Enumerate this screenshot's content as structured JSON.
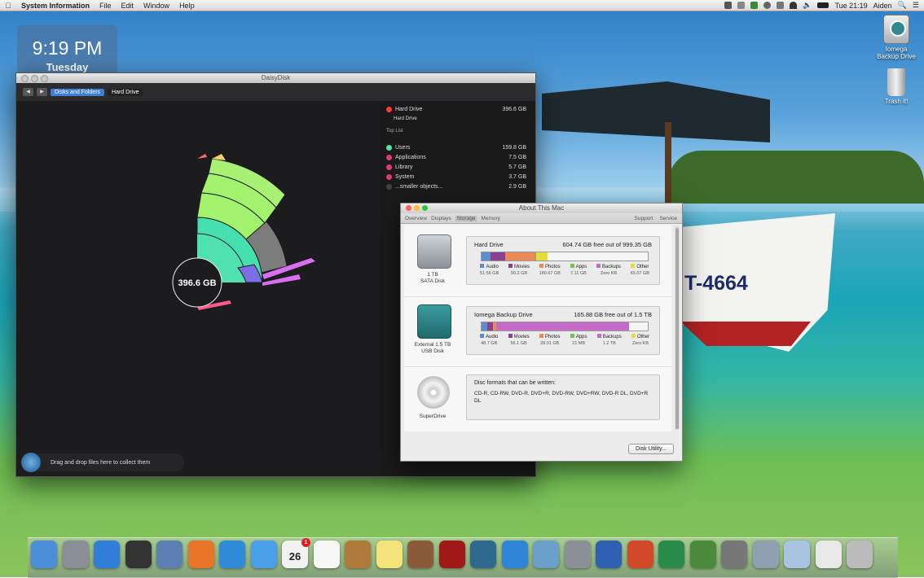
{
  "menubar": {
    "app_name": "System Information",
    "menus": [
      "File",
      "Edit",
      "Window",
      "Help"
    ],
    "clock": "Tue 21:19",
    "user": "Aiden"
  },
  "clock_widget": {
    "time": "9:19 PM",
    "day": "Tuesday"
  },
  "desktop_icons": [
    {
      "label": "Iomega\nBackup Drive",
      "icon": "backup-drive-icon"
    },
    {
      "label": "Trash it!",
      "icon": "trash-icon"
    }
  ],
  "boat_registration": "T-4664",
  "daisydisk": {
    "title": "DaisyDisk",
    "breadcrumbs": [
      "Disks and Folders",
      "Hard Drive"
    ],
    "center_label": "396.6 GB",
    "drive": {
      "name": "Hard Drive",
      "size": "396.6 GB",
      "sub": "Hard Drive"
    },
    "top_list_label": "Top List",
    "items": [
      {
        "name": "Users",
        "size": "159.8 GB",
        "color": "#55e3a4"
      },
      {
        "name": "Applications",
        "size": "7.5 GB",
        "color": "#e5397a"
      },
      {
        "name": "Library",
        "size": "5.7 GB",
        "color": "#e5397a"
      },
      {
        "name": "System",
        "size": "3.7 GB",
        "color": "#e5397a"
      },
      {
        "name": "...smaller objects...",
        "size": "2.9 GB",
        "color": "#444444"
      }
    ],
    "drop_hint": "Drag and drop files here to collect them"
  },
  "about_mac": {
    "title": "About This Mac",
    "tabs": [
      "Overview",
      "Displays",
      "Storage",
      "Memory"
    ],
    "selected_tab": "Storage",
    "right_links": [
      "Support",
      "Service"
    ],
    "disks": [
      {
        "name": "Hard Drive",
        "free": "604.74 GB free out of 999.35 GB",
        "caption": "1 TB\nSATA Disk",
        "segments": [
          {
            "label": "Audio",
            "size": "51.56 GB",
            "color": "#5b8bd1",
            "fraction": 0.052
          },
          {
            "label": "Movies",
            "size": "90.2 GB",
            "color": "#8a3f8f",
            "fraction": 0.09
          },
          {
            "label": "Photos",
            "size": "180.67 GB",
            "color": "#ec8a57",
            "fraction": 0.181
          },
          {
            "label": "Apps",
            "size": "7.11 GB",
            "color": "#74c158",
            "fraction": 0.007
          },
          {
            "label": "Backups",
            "size": "Zero KB",
            "color": "#c46bc7",
            "fraction": 0.0
          },
          {
            "label": "Other",
            "size": "65.07 GB",
            "color": "#e5dc3c",
            "fraction": 0.065
          }
        ]
      },
      {
        "name": "Iomega Backup Drive",
        "free": "165.88 GB free out of 1.5 TB",
        "caption": "External 1.5 TB\nUSB Disk",
        "segments": [
          {
            "label": "Audio",
            "size": "48.7 GB",
            "color": "#5b8bd1",
            "fraction": 0.032
          },
          {
            "label": "Movies",
            "size": "56.1 GB",
            "color": "#8a3f8f",
            "fraction": 0.037
          },
          {
            "label": "Photos",
            "size": "28.01 GB",
            "color": "#ec8a57",
            "fraction": 0.019
          },
          {
            "label": "Apps",
            "size": "21 MB",
            "color": "#74c158",
            "fraction": 0.0
          },
          {
            "label": "Backups",
            "size": "1.2 TB",
            "color": "#c46bc7",
            "fraction": 0.8
          },
          {
            "label": "Other",
            "size": "Zero KB",
            "color": "#e5dc3c",
            "fraction": 0.0
          }
        ]
      }
    ],
    "superdrive": {
      "caption": "SuperDrive",
      "heading": "Disc formats that can be written:",
      "formats": "CD-R, CD-RW, DVD-R, DVD+R, DVD-RW, DVD+RW, DVD-R DL, DVD+R DL"
    },
    "button": "Disk Utility..."
  },
  "dock": {
    "icons": [
      "finder-icon",
      "launchpad-icon",
      "app-store-icon",
      "dashboard-icon",
      "mail-stamp-icon",
      "firefox-icon",
      "safari-icon",
      "messages-icon",
      "calendar-icon",
      "reminders-icon",
      "address-book-icon",
      "notes-icon",
      "photo-booth-icon",
      "photo-slideshow-icon",
      "time-machine-icon",
      "itunes-icon",
      "iphoto-icon",
      "system-preferences-icon",
      "word-icon",
      "powerpoint-icon",
      "excel-icon",
      "home-icon",
      "network-icon",
      "disk-utility-icon",
      "folder-icon",
      "preview-icon",
      "trash-icon"
    ],
    "calendar_date": "26",
    "badge": "1"
  }
}
